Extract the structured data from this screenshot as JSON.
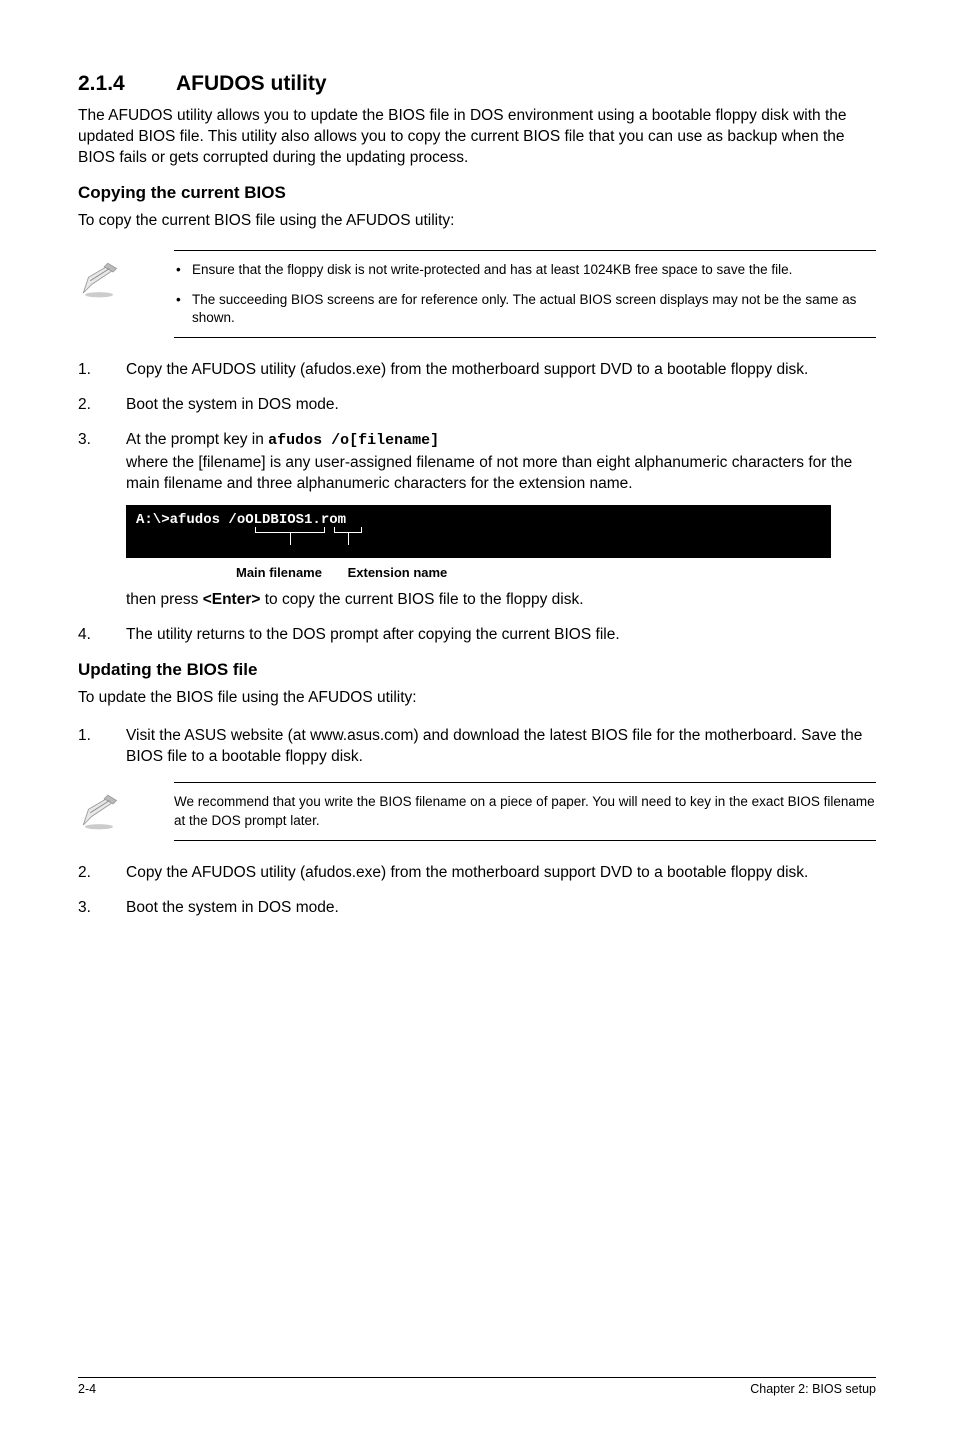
{
  "section": {
    "number": "2.1.4",
    "title": "AFUDOS utility",
    "intro": "The AFUDOS utility allows you to update the BIOS file in DOS environment using a bootable floppy disk with the updated BIOS file. This utility also allows you to copy the current BIOS file that you can use as backup when the BIOS fails or gets corrupted during the updating process."
  },
  "copying": {
    "heading": "Copying the current BIOS",
    "lead": "To copy the current BIOS file using the AFUDOS utility:",
    "notes": [
      "Ensure that the floppy disk is not write-protected and has at least 1024KB free space to save the file.",
      "The succeeding BIOS screens are for reference only. The actual BIOS screen displays may not be the same as shown."
    ],
    "steps": {
      "s1": "Copy the AFUDOS utility (afudos.exe) from the motherboard support DVD to a bootable floppy disk.",
      "s2": "Boot the system in DOS mode.",
      "s3a": "At the prompt key in ",
      "s3code": "afudos /o[filename]",
      "s3b": "where the [filename] is any user-assigned filename of not more than eight alphanumeric characters for the main filename and three alphanumeric characters for the extension name."
    },
    "terminal": {
      "line": "A:\\>afudos /oOLDBIOS1.rom",
      "label_main": "Main filename",
      "label_ext": "Extension name"
    },
    "after_terminal": {
      "then_a": "then press ",
      "enter": "<Enter>",
      "then_b": " to copy the current BIOS file to the floppy disk."
    },
    "step4": "The utility returns to the DOS prompt after copying the current BIOS file."
  },
  "updating": {
    "heading": "Updating the BIOS file",
    "lead": "To update the BIOS file using the AFUDOS utility:",
    "step1": "Visit the ASUS website (at www.asus.com) and download the latest BIOS file for the motherboard. Save the BIOS file to a bootable floppy disk.",
    "note": "We recommend that you write the BIOS filename on a piece of paper. You will need to key in the exact BIOS filename at the DOS prompt later.",
    "step2": "Copy the AFUDOS utility (afudos.exe) from the motherboard support DVD to a bootable floppy disk.",
    "step3": "Boot the system in DOS mode."
  },
  "footer": {
    "left": "2-4",
    "right": "Chapter 2: BIOS setup"
  }
}
